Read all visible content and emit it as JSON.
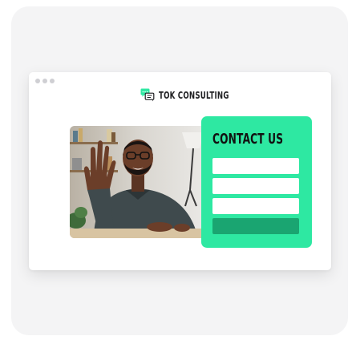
{
  "brand": {
    "name": "TOK CONSULTING",
    "icon": "chat-bubbles-icon",
    "icon_colors": {
      "front": "#2ee8a2",
      "back": "#1f1f22"
    }
  },
  "contact": {
    "title": "CONTACT US",
    "panel_color": "#2ee8a2",
    "button_color": "#1aa571",
    "fields": [
      {
        "value": ""
      },
      {
        "value": ""
      },
      {
        "value": ""
      }
    ],
    "submit_label": ""
  },
  "colors": {
    "accent": "#2ee8a2",
    "accent_dark": "#1aa571",
    "card_background": "#f4f4f5",
    "window_background": "#ffffff",
    "text": "#1f1f22"
  }
}
